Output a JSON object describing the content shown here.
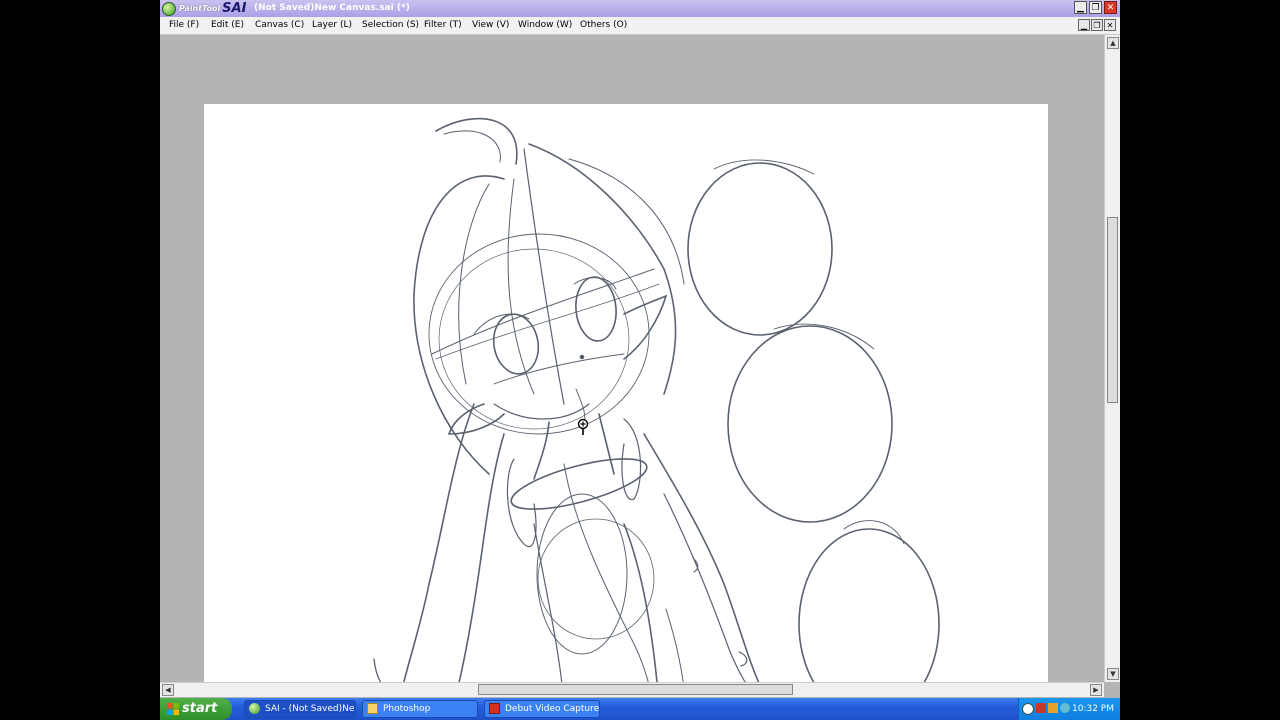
{
  "window": {
    "logo_small": "PaintTool",
    "logo_big": "SAI",
    "title": "(Not Saved)New Canvas.sai (*)",
    "btn_minimize": "▁",
    "btn_maximize": "❐",
    "btn_close": "✕"
  },
  "menu": {
    "items": [
      {
        "label": "File (F)"
      },
      {
        "label": "Edit (E)"
      },
      {
        "label": "Canvas (C)"
      },
      {
        "label": "Layer (L)"
      },
      {
        "label": "Selection (S)"
      },
      {
        "label": "Filter (T)"
      },
      {
        "label": "View (V)"
      },
      {
        "label": "Window (W)"
      },
      {
        "label": "Others (O)"
      }
    ]
  },
  "icons": {
    "zoom_cursor": "magnifier-plus-icon"
  },
  "taskbar": {
    "start_label": "start",
    "tasks": [
      {
        "label": "SAI - (Not Saved)Ne...",
        "active": true
      },
      {
        "label": "Photoshop",
        "active": false
      },
      {
        "label": "Debut Video Capture ...",
        "active": false
      }
    ],
    "clock": "10:32 PM"
  },
  "colors": {
    "title_bar": "#aaa0e6",
    "taskbar": "#245edb",
    "start_green": "#3a9a2a",
    "sketch_stroke": "#5a6270"
  }
}
